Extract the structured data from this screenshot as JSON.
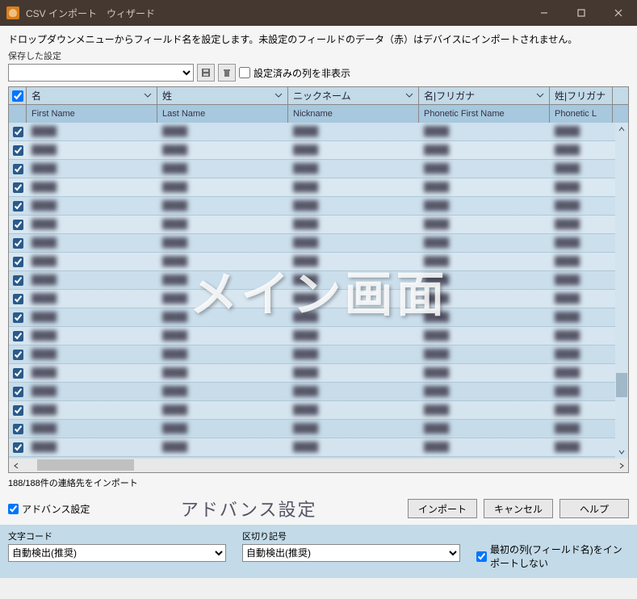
{
  "window": {
    "title": "CSV インポート　ウィザード"
  },
  "instruction": "ドロップダウンメニューからフィールド名を設定します。未設定のフィールドのデータ（赤）はデバイスにインポートされません。",
  "saved_settings": {
    "label": "保存した設定"
  },
  "hide_configured": {
    "label": "設定済みの列を非表示"
  },
  "columns": {
    "c1": "名",
    "c2": "姓",
    "c3": "ニックネーム",
    "c4": "名|フリガナ",
    "c5": "姓|フリガナ"
  },
  "subcolumns": {
    "c1": "First Name",
    "c2": "Last Name",
    "c3": "Nickname",
    "c4": "Phonetic First Name",
    "c5": "Phonetic L"
  },
  "watermark": "メイン画面",
  "status": "188/188件の連絡先をインポート",
  "advance_checkbox": "アドバンス設定",
  "advance_title": "アドバンス設定",
  "buttons": {
    "import": "インポート",
    "cancel": "キャンセル",
    "help": "ヘルプ"
  },
  "advance": {
    "charset_label": "文字コード",
    "charset_value": "自動検出(推奨)",
    "delimiter_label": "区切り記号",
    "delimiter_value": "自動検出(推奨)",
    "skip_header": "最初の列(フィールド名)をインポートしない"
  }
}
